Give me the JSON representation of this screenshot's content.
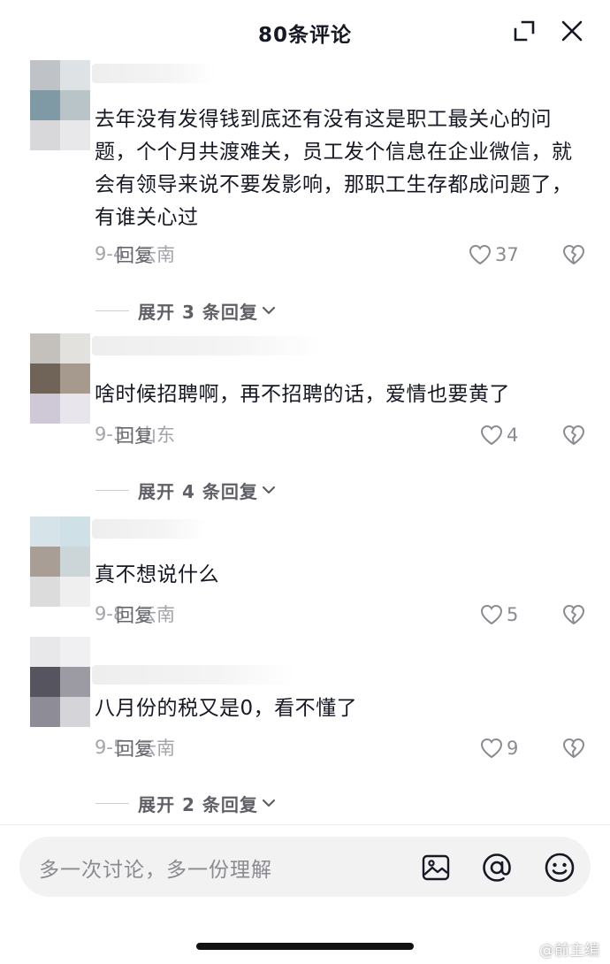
{
  "header": {
    "title": "80条评论",
    "collapse_icon": "collapse-corner-icon",
    "close_icon": "close-icon"
  },
  "comments": [
    {
      "text": "去年没有发得钱到底还有没有这是职工最关心的问题，个个月共渡难关，员工发个信息在企业微信，就会有领导来说不要发影响，那职工生存都成问题了，有谁关心过",
      "date": "9-4",
      "location": "云南",
      "reply_label": "回复",
      "likes": "37",
      "expand_label": "展开 3 条回复"
    },
    {
      "text": "啥时候招聘啊，再不招聘的话，爱情也要黄了",
      "date": "9-3",
      "location": "山东",
      "reply_label": "回复",
      "likes": "4",
      "expand_label": "展开 4 条回复"
    },
    {
      "text": "真不想说什么",
      "date": "9-8",
      "location": "云南",
      "reply_label": "回复",
      "likes": "5"
    },
    {
      "text": "八月份的税又是0，看不懂了",
      "date": "9-5",
      "location": "云南",
      "reply_label": "回复",
      "likes": "9",
      "expand_label": "展开 2 条回复"
    }
  ],
  "meta_separator": "·",
  "input": {
    "placeholder": "多一次讨论，多一份理解",
    "icons": [
      "image-icon",
      "at-icon",
      "emoji-icon"
    ]
  },
  "watermark": "@前主编",
  "colors": {
    "text": "#161823",
    "secondary": "#8a8b91",
    "input_bg": "#f2f2f3"
  }
}
